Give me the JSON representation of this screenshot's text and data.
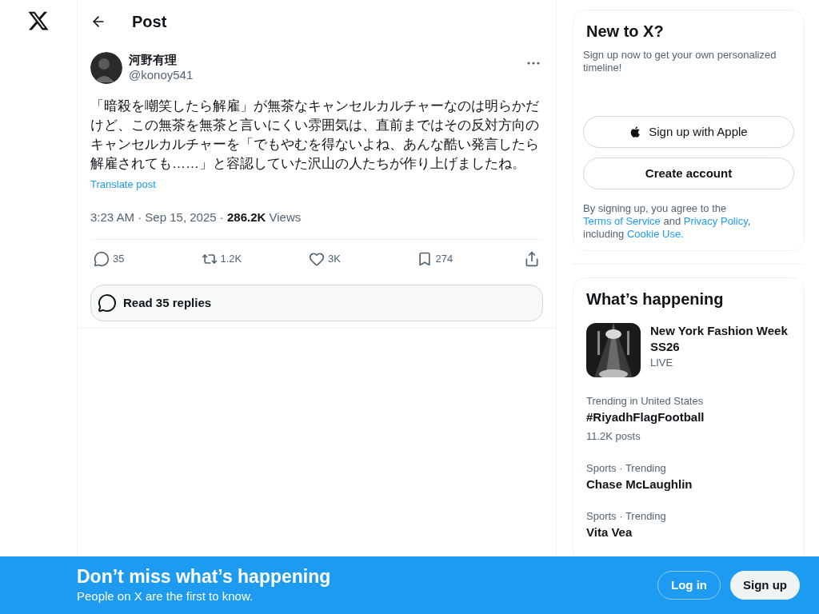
{
  "header": {
    "title": "Post"
  },
  "post": {
    "author": {
      "name": "河野有理",
      "handle": "@konoy541"
    },
    "text": "「暗殺を嘲笑したら解雇」が無茶なキャンセルカルチャーなのは明らかだけど、この無茶を無茶と言いにくい雰囲気は、直前まではその反対方向のキャンセルカルチャーを「でもやむを得ないよね、あんな酷い発言したら解雇されても……」と容認していた沢山の人たちが作り上げましたね。",
    "translate": "Translate post",
    "timestamp": "3:23 AM · Sep 15, 2025 · ",
    "views_count": "286.2K",
    "views_label": " Views",
    "actions": [
      {
        "kind": "reply",
        "count": "35"
      },
      {
        "kind": "repost",
        "count": "1.2K"
      },
      {
        "kind": "like",
        "count": "3K"
      },
      {
        "kind": "bookmark",
        "count": "274"
      },
      {
        "kind": "share"
      }
    ],
    "read_replies": "Read 35 replies"
  },
  "signup": {
    "title": "New to X?",
    "subtitle": "Sign up now to get your own personalized timeline!",
    "apple_button": "Sign up with Apple",
    "create_button": "Create account",
    "legal": [
      {
        "kind": "text",
        "text": "By signing up, you agree to the "
      },
      {
        "kind": "link",
        "text": "Terms of Service"
      },
      {
        "kind": "text",
        "text": " and "
      },
      {
        "kind": "link",
        "text": "Privacy Policy"
      },
      {
        "kind": "text",
        "text": ", including "
      },
      {
        "kind": "link",
        "text": "Cookie Use."
      }
    ]
  },
  "trends": {
    "title": "What’s happening",
    "items": [
      {
        "kind": "event",
        "name": "New York Fashion Week SS26",
        "meta": "LIVE"
      },
      {
        "kind": "trend",
        "context": "Trending in United States",
        "name": "#RiyadhFlagFootball",
        "meta": "11.2K posts"
      },
      {
        "kind": "trend",
        "context": "Sports · Trending",
        "name": "Chase McLaughlin"
      },
      {
        "kind": "trend",
        "context": "Sports · Trending",
        "name": "Vita Vea"
      }
    ]
  },
  "banner": {
    "title": "Don’t miss what’s happening",
    "subtitle": "People on X are the first to know.",
    "login": "Log in",
    "signup": "Sign up"
  }
}
